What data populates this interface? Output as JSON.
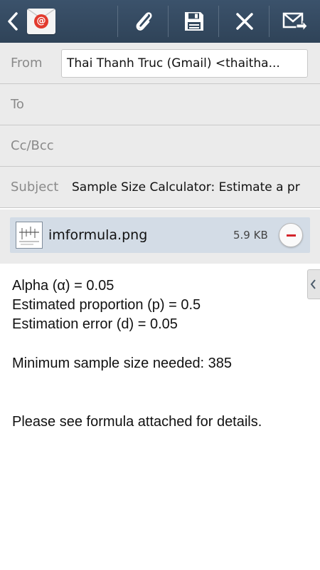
{
  "action_bar": {
    "back_icon": "chevron-left-icon",
    "app_icon": "email-app-icon",
    "actions": [
      {
        "name": "attach",
        "icon": "paperclip-icon"
      },
      {
        "name": "save",
        "icon": "save-icon"
      },
      {
        "name": "discard",
        "icon": "close-icon"
      },
      {
        "name": "send",
        "icon": "send-icon"
      }
    ],
    "colors": {
      "background": "#34495e",
      "icon": "#ffffff"
    }
  },
  "fields": {
    "from_label": "From",
    "from_value": "Thai Thanh Truc (Gmail) <thaitha...",
    "to_label": "To",
    "ccbcc_label": "Cc/Bcc",
    "subject_label": "Subject",
    "subject_value": "Sample Size Calculator: Estimate a pr"
  },
  "attachment": {
    "file_name": "imformula.png",
    "file_size": "5.9 KB",
    "remove_icon": "minus-icon",
    "colors": {
      "card": "#d3dce6",
      "remove": "#d3242b"
    }
  },
  "body": {
    "lines": [
      "Alpha (α) = 0.05",
      "Estimated proportion (p) = 0.5",
      "Estimation error (d) = 0.05",
      "Minimum sample size needed: 385",
      "Please see formula attached for details."
    ]
  }
}
